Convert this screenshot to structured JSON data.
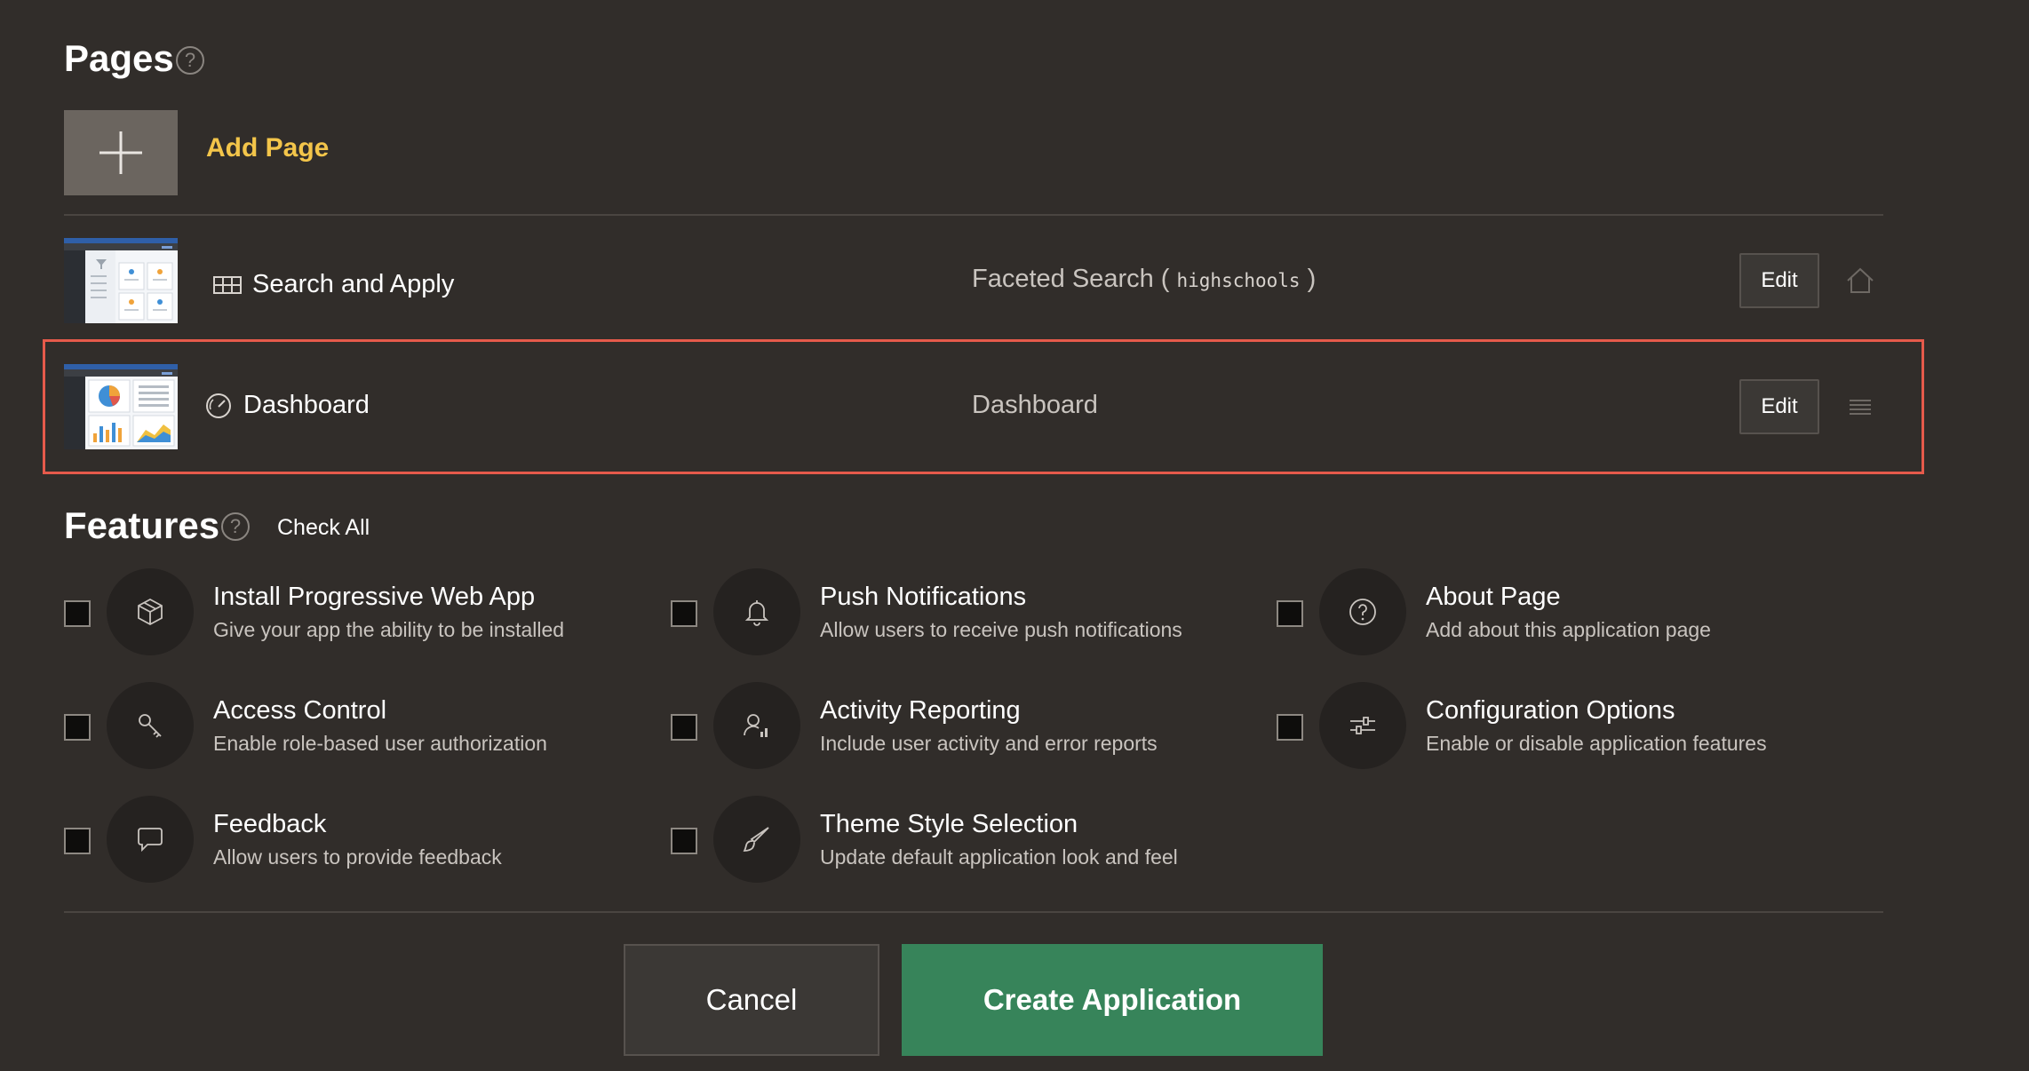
{
  "pages_section": {
    "title": "Pages",
    "help_icon": "question-circle-icon",
    "add_page_label": "Add Page",
    "rows": [
      {
        "name": "Search and Apply",
        "type_prefix": "Faceted Search ( ",
        "type_table": "highschools",
        "type_suffix": " )",
        "edit_label": "Edit",
        "row_icon": "home-icon"
      },
      {
        "name": "Dashboard",
        "type_prefix": "Dashboard",
        "edit_label": "Edit",
        "row_icon": "drag-handle-icon"
      }
    ]
  },
  "features_section": {
    "title": "Features",
    "check_all_label": "Check All",
    "items": [
      {
        "title": "Install Progressive Web App",
        "desc": "Give your app the ability to be installed",
        "icon": "package-icon"
      },
      {
        "title": "Push Notifications",
        "desc": "Allow users to receive push notifications",
        "icon": "bell-icon"
      },
      {
        "title": "About Page",
        "desc": "Add about this application page",
        "icon": "question-circle-icon"
      },
      {
        "title": "Access Control",
        "desc": "Enable role-based user authorization",
        "icon": "key-icon"
      },
      {
        "title": "Activity Reporting",
        "desc": "Include user activity and error reports",
        "icon": "user-chart-icon"
      },
      {
        "title": "Configuration Options",
        "desc": "Enable or disable application features",
        "icon": "sliders-icon"
      },
      {
        "title": "Feedback",
        "desc": "Allow users to provide feedback",
        "icon": "chat-bubble-icon"
      },
      {
        "title": "Theme Style Selection",
        "desc": "Update default application look and feel",
        "icon": "brush-icon"
      }
    ]
  },
  "footer": {
    "cancel_label": "Cancel",
    "create_label": "Create Application"
  },
  "colors": {
    "background": "#312d2a",
    "accent_yellow": "#f3c54a",
    "create_green": "#37845a",
    "highlight_red": "#e65a4b"
  }
}
